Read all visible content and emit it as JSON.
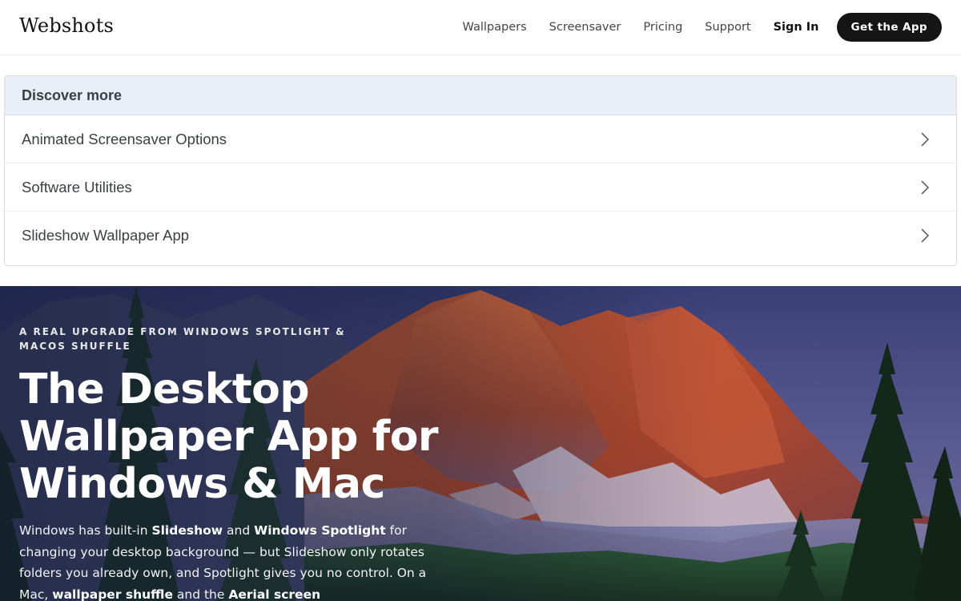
{
  "header": {
    "logo": "Webshots",
    "nav": [
      "Wallpapers",
      "Screensaver",
      "Pricing",
      "Support"
    ],
    "signin": "Sign In",
    "cta": "Get the App"
  },
  "discover": {
    "title": "Discover more",
    "items": [
      {
        "label": "Animated Screensaver Options",
        "icon": "chevron-right-icon"
      },
      {
        "label": "Software Utilities",
        "icon": "chevron-right-icon"
      },
      {
        "label": "Slideshow Wallpaper App",
        "icon": "chevron-right-icon"
      }
    ]
  },
  "hero": {
    "eyebrow": "A REAL UPGRADE FROM WINDOWS SPOTLIGHT & MACOS SHUFFLE",
    "title": "The Desktop Wallpaper App for Windows & Mac",
    "body": {
      "t1": "Windows has built-in ",
      "b1": "Slideshow",
      "t2": " and ",
      "b2": "Windows Spotlight",
      "t3": " for changing your desktop background — but Slideshow only rotates folders you already own, and Spotlight gives you no control. On a Mac, ",
      "b3": "wallpaper shuffle",
      "t4": " and the ",
      "b4": "Aerial screen"
    }
  },
  "colors": {
    "cta_bg": "#151515",
    "discover_head_bg": "#e9eef9",
    "hero_text": "#ffffff"
  }
}
